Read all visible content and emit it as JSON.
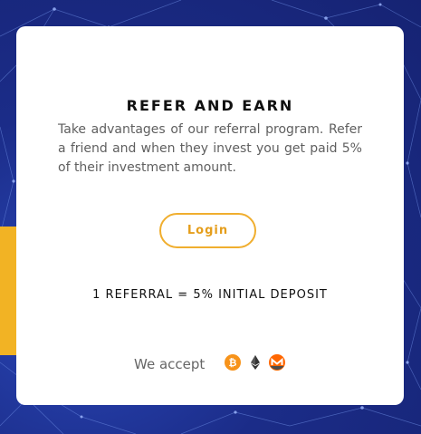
{
  "section": {
    "title": "REFER AND EARN",
    "description": "Take advantages of our referral program. Refer a friend and when they invest you get paid 5% of their investment amount.",
    "login_label": "Login",
    "referral_text": "1 REFERRAL = 5% INITIAL DEPOSIT",
    "accept_label": "We accept"
  },
  "payment_icons": [
    "bitcoin-icon",
    "ethereum-icon",
    "monero-icon"
  ],
  "colors": {
    "background": "#1c2f8f",
    "accent": "#f0ae2e",
    "bitcoin": "#f7931a",
    "monero": "#ff6600"
  }
}
